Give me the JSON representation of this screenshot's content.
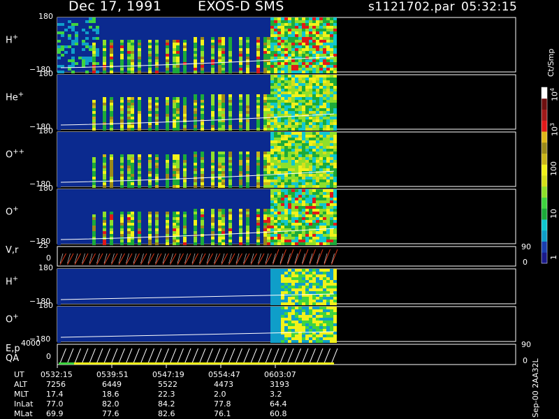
{
  "header": {
    "date": "Dec 17, 1991",
    "mission": "EXOS-D SMS",
    "file": "s1121702.par",
    "time": "05:32:15"
  },
  "colors": {
    "background": "#000000",
    "sheath": "#0b2a8f",
    "palette": [
      "#1a1a8c",
      "#1a3fb0",
      "#0f9ec9",
      "#10c8d0",
      "#1cab3a",
      "#3fd43f",
      "#8fe02a",
      "#d6e01a",
      "#f2f21a",
      "#c9b51a",
      "#9c8a1a",
      "#e0b81a",
      "#e01a1a",
      "#a01a1a",
      "#6e1010",
      "#ffffff"
    ]
  },
  "panels": [
    {
      "label": "H",
      "sup": "+",
      "top_tick": "180",
      "bottom_tick": "−180"
    },
    {
      "label": "He",
      "sup": "+",
      "top_tick": "180",
      "bottom_tick": "−180"
    },
    {
      "label": "O",
      "sup": "++",
      "top_tick": "180",
      "bottom_tick": "−180"
    },
    {
      "label": "O",
      "sup": "+",
      "top_tick": "180",
      "bottom_tick": "−180"
    },
    {
      "label": "V,r",
      "sup": "",
      "top_tick": "25",
      "bottom_tick": "0",
      "right_top": "90",
      "right_bottom": "0"
    },
    {
      "label": "H",
      "sup": "+",
      "top_tick": "180",
      "bottom_tick": "−180"
    },
    {
      "label": "O",
      "sup": "+",
      "top_tick": "180",
      "bottom_tick": "−180"
    },
    {
      "label": "E,p",
      "label2": "QA",
      "sup": "",
      "top_tick": "4000",
      "bottom_tick": "0",
      "right_top": "90",
      "right_bottom": "0"
    }
  ],
  "colorbar": {
    "title": "Ct/Smp",
    "labels": [
      {
        "base": "10",
        "exp": "4"
      },
      {
        "base": "10",
        "exp": "3"
      },
      {
        "base": "100",
        "exp": ""
      },
      {
        "base": "10",
        "exp": ""
      },
      {
        "base": "1",
        "exp": ""
      }
    ]
  },
  "footer": {
    "rows": [
      {
        "name": "UT",
        "values": [
          "0532:15",
          "0539:51",
          "0547:19",
          "0554:47",
          "0603:07"
        ]
      },
      {
        "name": "ALT",
        "values": [
          "7256",
          "6449",
          "5522",
          "4473",
          "3193"
        ]
      },
      {
        "name": "MLT",
        "values": [
          "17.4",
          "18.6",
          "22.3",
          "2.0",
          "3.2"
        ]
      },
      {
        "name": "InLat",
        "values": [
          "77.0",
          "82.0",
          "84.2",
          "77.8",
          "64.4"
        ]
      },
      {
        "name": "MLat",
        "values": [
          "69.9",
          "77.6",
          "82.6",
          "76.1",
          "60.8"
        ]
      }
    ],
    "stamp": "Sep-00 2AA32L"
  },
  "chart_data": {
    "type": "heatmap",
    "title": "Dec 17, 1991 EXOS-D SMS",
    "x": [
      "0532:15",
      "0539:51",
      "0547:19",
      "0554:47",
      "0603:07"
    ],
    "xlabel": "UT",
    "series": [
      {
        "name": "H+",
        "ylim": [
          -180,
          180
        ]
      },
      {
        "name": "He+",
        "ylim": [
          -180,
          180
        ]
      },
      {
        "name": "O++",
        "ylim": [
          -180,
          180
        ]
      },
      {
        "name": "O+",
        "ylim": [
          -180,
          180
        ]
      },
      {
        "name": "V,r",
        "ylim": [
          0,
          25
        ]
      },
      {
        "name": "H+",
        "ylim": [
          -180,
          180
        ]
      },
      {
        "name": "O+",
        "ylim": [
          -180,
          180
        ]
      },
      {
        "name": "E,p",
        "ylim": [
          0,
          4000
        ]
      }
    ],
    "colorscale": {
      "label": "Ct/Smp",
      "scale": "log",
      "range": [
        1,
        10000
      ]
    },
    "grid": false
  }
}
